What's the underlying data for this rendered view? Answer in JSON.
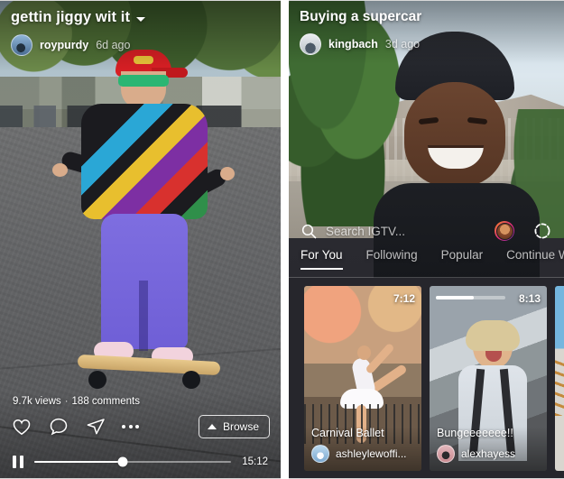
{
  "left_panel": {
    "name": "igtv-video-player",
    "title": "gettin jiggy wit it",
    "title_chevron": "chevron-down-icon",
    "username": "roypurdy",
    "timestamp": "6d ago",
    "stats": {
      "views": "9.7k views",
      "separator": "·",
      "comments": "188 comments"
    },
    "actions": [
      {
        "name": "like-icon",
        "label": "heart-icon"
      },
      {
        "name": "comment-icon",
        "label": "comment-bubble-icon"
      },
      {
        "name": "share-icon",
        "label": "paper-plane-icon"
      },
      {
        "name": "more-icon",
        "label": "ellipsis-icon"
      }
    ],
    "browse_button": {
      "label": "Browse",
      "icon": "chevron-up-icon"
    },
    "player": {
      "state_icon": "pause-icon",
      "progress_percent": 45,
      "time_remaining": "15:12"
    }
  },
  "right_panel": {
    "name": "igtv-browse",
    "title": "Buying a supercar",
    "username": "kingbach",
    "timestamp": "3d ago",
    "search": {
      "icon": "search-icon",
      "placeholder": "Search IGTV...",
      "avatar_name": "profile-avatar-with-story-ring",
      "live_icon": "camera-live-icon"
    },
    "tabs": [
      {
        "label": "For You",
        "active": true
      },
      {
        "label": "Following",
        "active": false
      },
      {
        "label": "Popular",
        "active": false
      },
      {
        "label": "Continue W",
        "active": false
      }
    ],
    "cards": [
      {
        "title": "Carnival Ballet",
        "username": "ashleylewoffi...",
        "duration": "7:12",
        "has_progress": false,
        "progress_percent": 0
      },
      {
        "title": "Bungeeeeeee!!",
        "username": "alexhayess",
        "duration": "8:13",
        "has_progress": true,
        "progress_percent": 55
      }
    ]
  },
  "colors": {
    "accent_white": "#ffffff",
    "carousel_background": "#26262c",
    "story_ring_start": "#f58529",
    "story_ring_mid": "#dd2a7b",
    "story_ring_end": "#8134af"
  }
}
